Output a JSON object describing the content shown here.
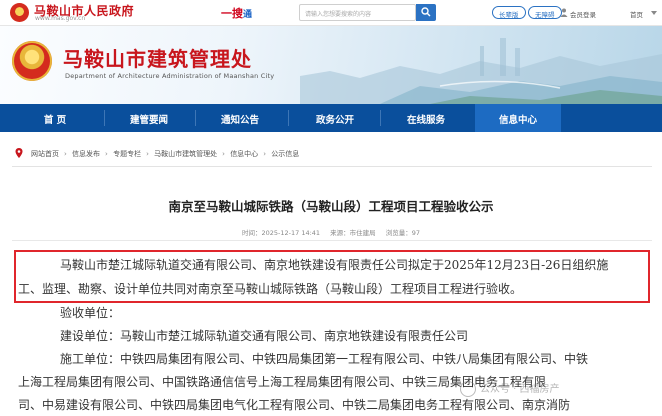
{
  "topbar": {
    "gov_name": "马鞍山市人民政府",
    "gov_url": "www.mas.gov.cn",
    "search_brand_main": "一搜",
    "search_brand_sub": "通",
    "search_placeholder": "请输入您想要搜索的内容",
    "elder_mode": "长辈版",
    "accessibility": "无障碍",
    "login": "会员登录",
    "homepage": "首页"
  },
  "banner": {
    "title": "马鞍山市建筑管理处",
    "subtitle_en": "Department of Architecture Administration of Maanshan City"
  },
  "nav": {
    "items": [
      {
        "label": "首 页"
      },
      {
        "label": "建管要闻"
      },
      {
        "label": "通知公告"
      },
      {
        "label": "政务公开"
      },
      {
        "label": "在线服务"
      },
      {
        "label": "信息中心"
      }
    ]
  },
  "breadcrumb": {
    "items": [
      "网站首页",
      "信息发布",
      "专题专栏",
      "马鞍山市建筑管理处",
      "信息中心",
      "公示信息"
    ]
  },
  "article": {
    "title": "南京至马鞍山城际铁路（马鞍山段）工程项目工程验收公示",
    "time": "时间：2025-12-17 14:41",
    "source": "来源：市住建局",
    "views": "浏览量：97",
    "lines": [
      "马鞍山市楚江城际轨道交通有限公司、南京地铁建设有限责任公司拟定于2025年12月23日-26日组织施",
      "工、监理、勘察、设计单位共同对南京至马鞍山城际铁路（马鞍山段）工程项目工程进行验收。",
      "验收单位：",
      "建设单位：马鞍山市楚江城际轨道交通有限公司、南京地铁建设有限责任公司",
      "施工单位：中铁四局集团有限公司、中铁四局集团第一工程有限公司、中铁八局集团有限公司、中铁",
      "上海工程局集团有限公司、中国铁路通信信号上海工程局集团有限公司、中铁三局集团电务工程有限",
      "司、中易建设有限公司、中铁四局集团电气化工程有限公司、中铁二局集团电务工程有限公司、南京消防"
    ]
  },
  "watermark": "公众号 · 西福房产",
  "colors": {
    "nav_bg": "#0a4f9c",
    "nav_active": "#1d6bc2",
    "brand_red": "#c8161d",
    "highlight_border": "#e0262c"
  }
}
